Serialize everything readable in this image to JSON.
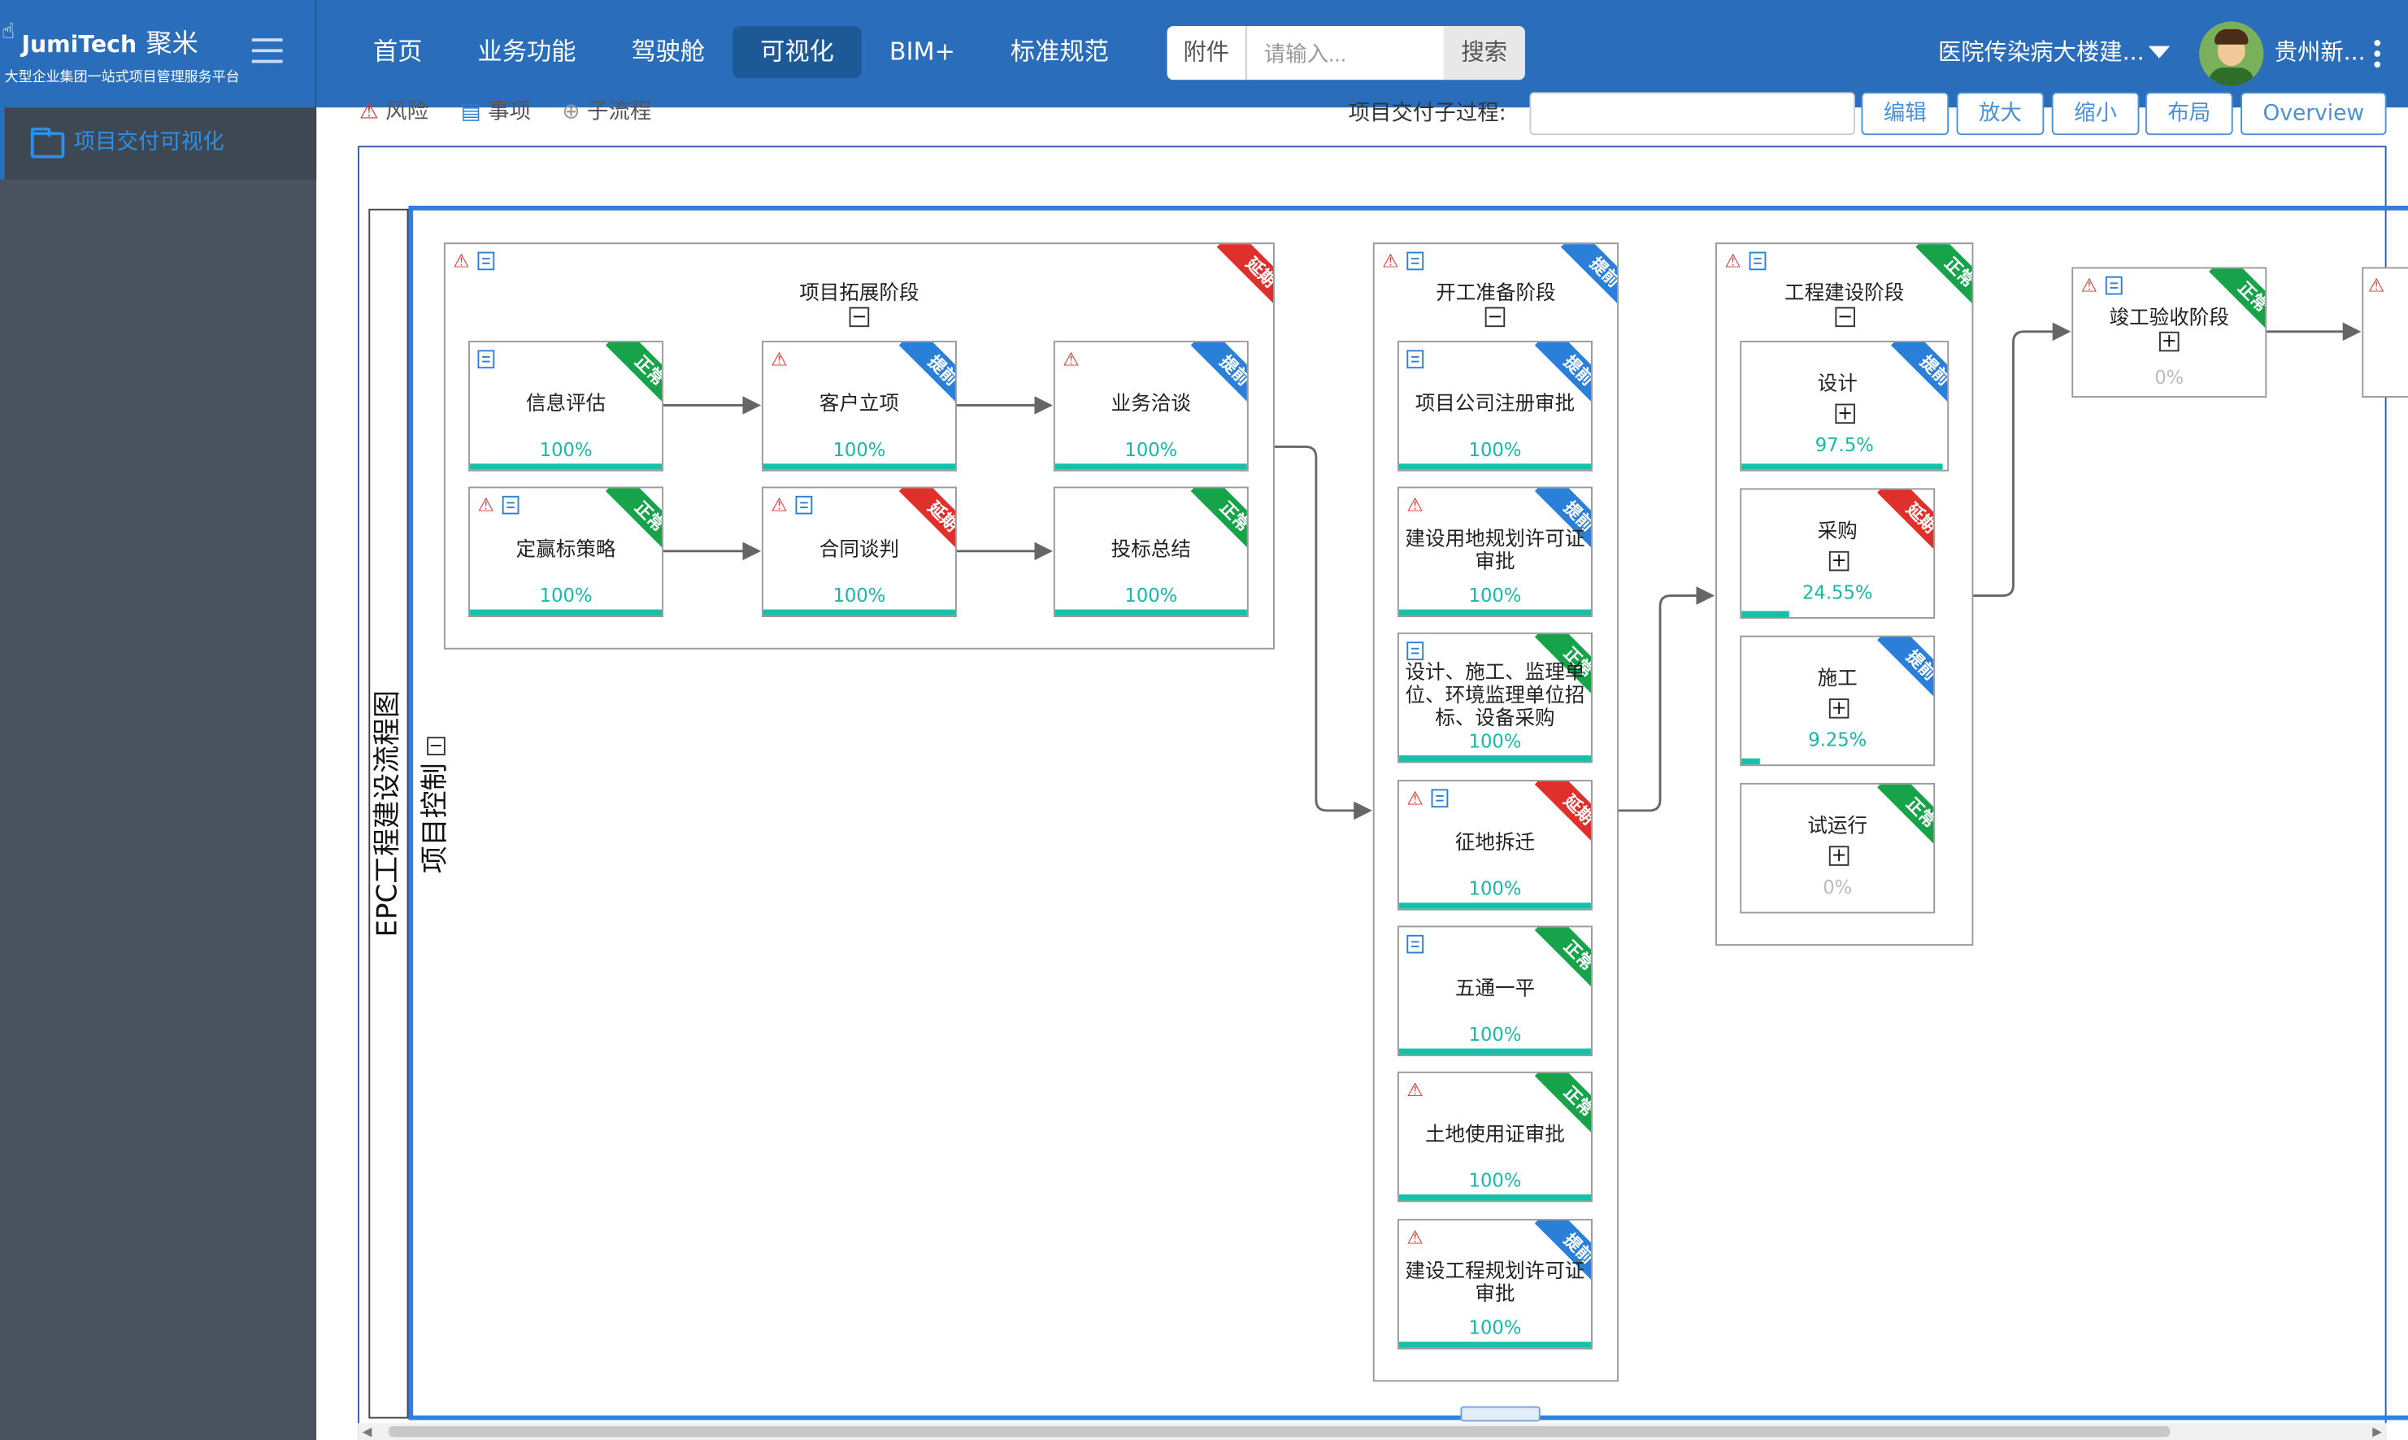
{
  "brand": {
    "name": "JumiTech",
    "name_cn": "聚米",
    "subtitle": "大型企业集团一站式项目管理服务平台"
  },
  "nav": [
    "首页",
    "业务功能",
    "驾驶舱",
    "可视化",
    "BIM+",
    "标准规范"
  ],
  "nav_active": "可视化",
  "search": {
    "prefix": "附件",
    "placeholder": "请输入...",
    "button": "搜索"
  },
  "project_select": "医院传染病大楼建...",
  "user": {
    "name": "贵州新..."
  },
  "sidebar": {
    "items": [
      {
        "label": "项目交付可视化",
        "icon": "folder-icon"
      }
    ]
  },
  "toolbar": {
    "legend": [
      "风险",
      "事项",
      "子流程"
    ],
    "process_label": "项目交付子过程:",
    "process_value": "",
    "buttons": [
      "编辑",
      "放大",
      "缩小",
      "布局",
      "Overview"
    ]
  },
  "diagram": {
    "pool_title": "EPC工程建设流程图",
    "lane_title": "项目控制",
    "status_colors": {
      "正常": "#16a34a",
      "提前": "#2a7fd8",
      "延期": "#e0302b"
    },
    "groups": [
      {
        "id": "g1",
        "title": "项目拓展阶段",
        "status": "延期",
        "icons": [
          "warn",
          "doc"
        ],
        "toggle": "−"
      },
      {
        "id": "g2",
        "title": "开工准备阶段",
        "status": "提前",
        "icons": [
          "warn",
          "doc"
        ],
        "toggle": "−"
      },
      {
        "id": "g3",
        "title": "工程建设阶段",
        "status": "正常",
        "icons": [
          "warn",
          "doc"
        ],
        "toggle": "−"
      },
      {
        "id": "g4",
        "title": "竣工验收阶段",
        "status": "正常",
        "icons": [
          "warn",
          "doc"
        ],
        "toggle": "+",
        "progress": "0%",
        "progress_value": 0
      }
    ],
    "tasks": [
      {
        "id": "t1",
        "name": "信息评估",
        "progress": "100%",
        "progress_value": 1.0,
        "status": "正常",
        "icons": [
          "doc"
        ]
      },
      {
        "id": "t2",
        "name": "客户立项",
        "progress": "100%",
        "progress_value": 1.0,
        "status": "提前",
        "icons": [
          "warn"
        ]
      },
      {
        "id": "t3",
        "name": "业务洽谈",
        "progress": "100%",
        "progress_value": 1.0,
        "status": "提前",
        "icons": [
          "warn"
        ]
      },
      {
        "id": "t4",
        "name": "定赢标策略",
        "progress": "100%",
        "progress_value": 1.0,
        "status": "正常",
        "icons": [
          "warn",
          "doc"
        ]
      },
      {
        "id": "t5",
        "name": "合同谈判",
        "progress": "100%",
        "progress_value": 1.0,
        "status": "延期",
        "icons": [
          "warn",
          "doc"
        ]
      },
      {
        "id": "t6",
        "name": "投标总结",
        "progress": "100%",
        "progress_value": 1.0,
        "status": "正常",
        "icons": []
      },
      {
        "id": "t7",
        "name": "项目公司注册审批",
        "progress": "100%",
        "progress_value": 1.0,
        "status": "提前",
        "icons": [
          "doc"
        ]
      },
      {
        "id": "t8",
        "name": "建设用地规划许可证审批",
        "progress": "100%",
        "progress_value": 1.0,
        "status": "提前",
        "icons": [
          "warn"
        ]
      },
      {
        "id": "t9",
        "name": "设计、施工、监理单位、环境监理单位招标、设备采购",
        "progress": "100%",
        "progress_value": 1.0,
        "status": "正常",
        "icons": [
          "doc"
        ]
      },
      {
        "id": "t10",
        "name": "征地拆迁",
        "progress": "100%",
        "progress_value": 1.0,
        "status": "延期",
        "icons": [
          "warn",
          "doc"
        ]
      },
      {
        "id": "t11",
        "name": "五通一平",
        "progress": "100%",
        "progress_value": 1.0,
        "status": "正常",
        "icons": [
          "doc"
        ]
      },
      {
        "id": "t12",
        "name": "土地使用证审批",
        "progress": "100%",
        "progress_value": 1.0,
        "status": "正常",
        "icons": [
          "warn"
        ]
      },
      {
        "id": "t13",
        "name": "建设工程规划许可证审批",
        "progress": "100%",
        "progress_value": 1.0,
        "status": "提前",
        "icons": [
          "warn"
        ]
      },
      {
        "id": "t14",
        "name": "设计",
        "progress": "97.5%",
        "progress_value": 0.975,
        "status": "提前",
        "icons": [],
        "toggle": "+"
      },
      {
        "id": "t15",
        "name": "采购",
        "progress": "24.55%",
        "progress_value": 0.2455,
        "status": "延期",
        "icons": [],
        "toggle": "+"
      },
      {
        "id": "t16",
        "name": "施工",
        "progress": "9.25%",
        "progress_value": 0.0925,
        "status": "提前",
        "icons": [],
        "toggle": "+"
      },
      {
        "id": "t17",
        "name": "试运行",
        "progress": "0%",
        "progress_value": 0,
        "status": "正常",
        "icons": [],
        "toggle": "+"
      }
    ]
  }
}
